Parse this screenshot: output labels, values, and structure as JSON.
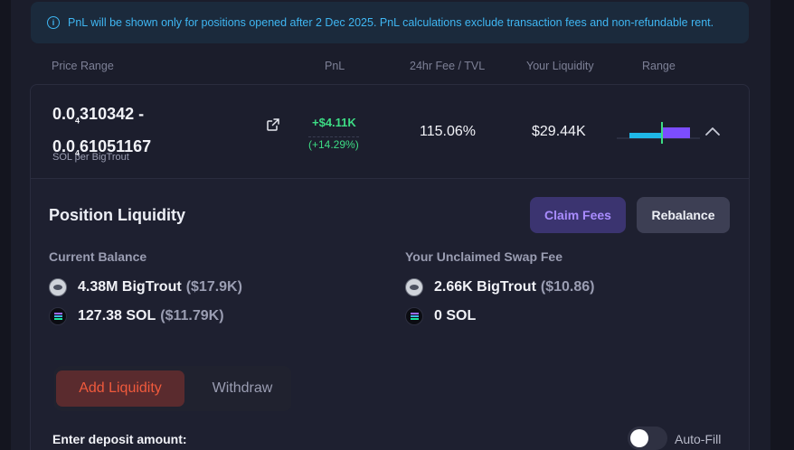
{
  "notice": {
    "icon": "info-icon",
    "text": "PnL will be shown only for positions opened after 2 Dec 2025. PnL calculations exclude transaction fees and non-refundable rent."
  },
  "columns": {
    "price_range": "Price Range",
    "pnl": "PnL",
    "fee_tvl": "24hr Fee / TVL",
    "your_liquidity": "Your Liquidity",
    "range": "Range"
  },
  "position": {
    "price_low_prefix": "0.0",
    "price_low_sub": "4",
    "price_low_rest": "310342 -",
    "price_high_prefix": "0.0",
    "price_high_sub": "4",
    "price_high_rest": "61051167",
    "unit": "SOL per BigTrout",
    "pnl_value": "+$4.11K",
    "pnl_percent": "(+14.29%)",
    "fee_tvl": "115.06%",
    "liquidity": "$29.44K",
    "colors": {
      "positive": "#3ddc84",
      "range_in": "#1fb8e8",
      "range_active": "#7c4dff"
    }
  },
  "position_liquidity": {
    "title": "Position Liquidity",
    "claim_fees": "Claim Fees",
    "rebalance": "Rebalance",
    "current_balance_label": "Current Balance",
    "unclaimed_label": "Your Unclaimed Swap Fee",
    "balance": [
      {
        "amount": "4.38M BigTrout",
        "usd": "($17.9K)",
        "icon": "bigtrout-token-icon"
      },
      {
        "amount": "127.38 SOL",
        "usd": "($11.79K)",
        "icon": "sol-token-icon"
      }
    ],
    "unclaimed": [
      {
        "amount": "2.66K BigTrout",
        "usd": "($10.86)",
        "icon": "bigtrout-token-icon"
      },
      {
        "amount": "0 SOL",
        "usd": "",
        "icon": "sol-token-icon"
      }
    ]
  },
  "tabs": {
    "add": "Add Liquidity",
    "withdraw": "Withdraw",
    "active": "add"
  },
  "deposit": {
    "label": "Enter deposit amount:",
    "autofill_label": "Auto-Fill",
    "autofill_on": false
  }
}
